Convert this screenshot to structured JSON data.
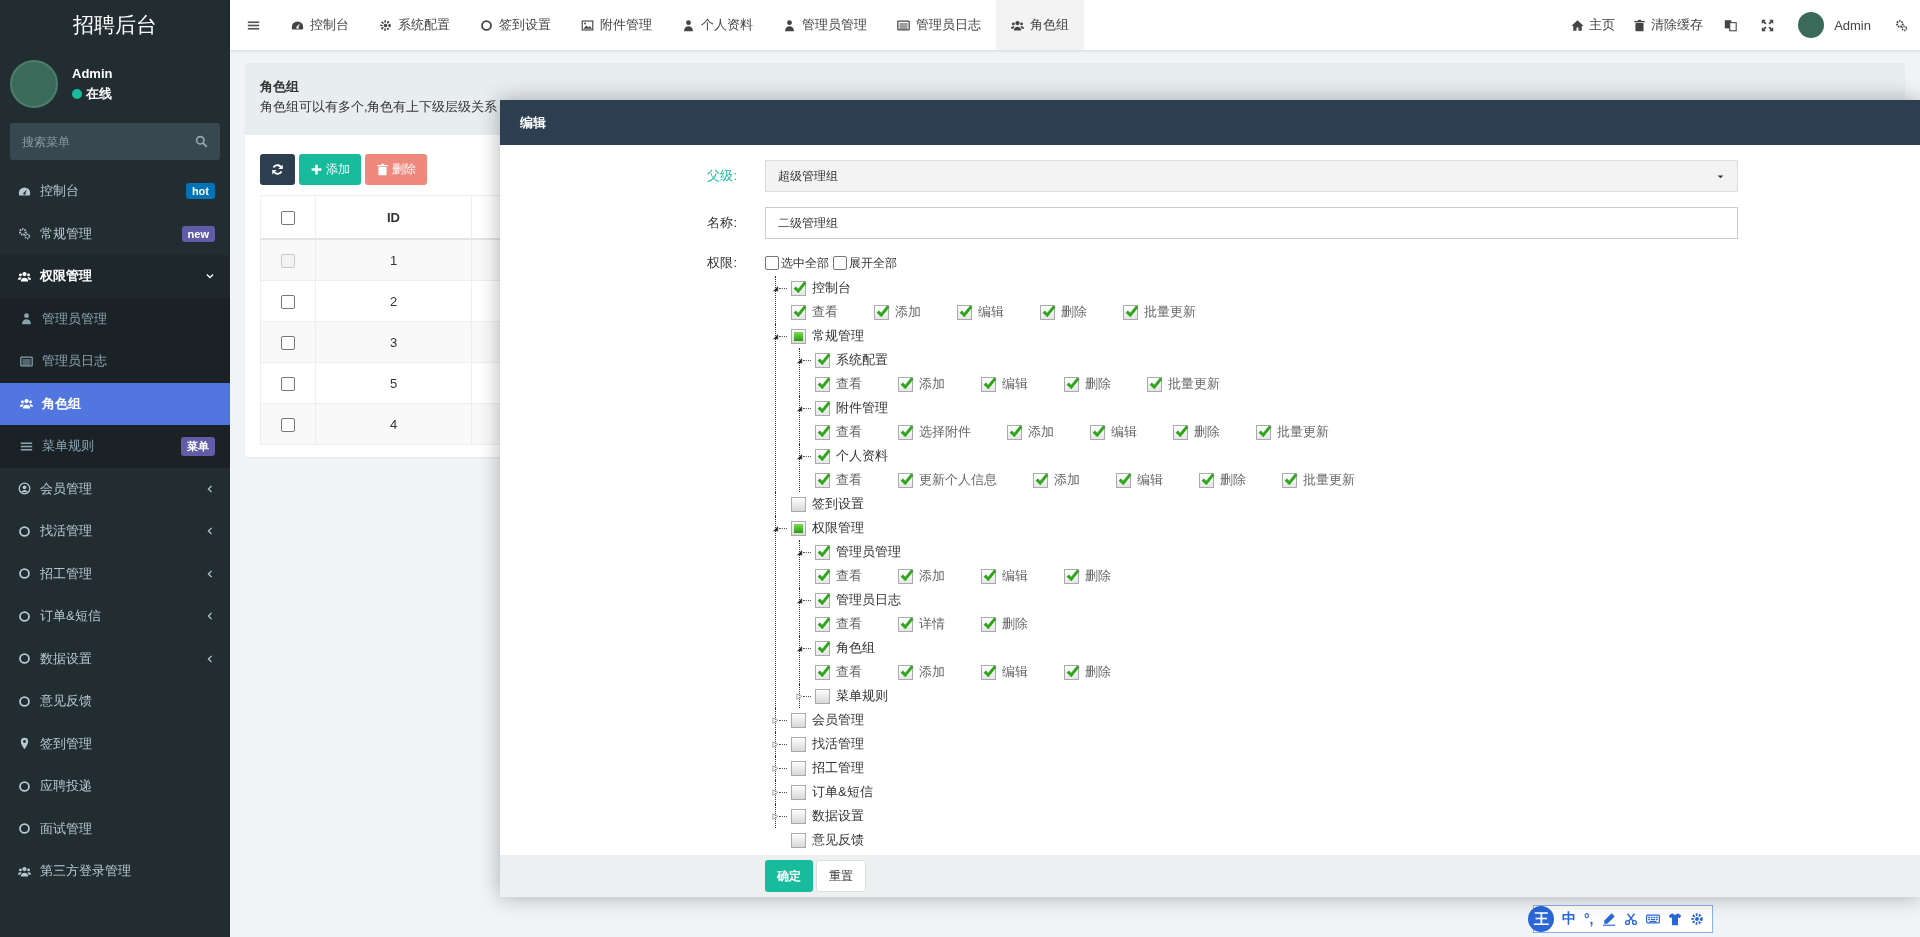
{
  "sidebar": {
    "title": "招聘后台",
    "user": {
      "name": "Admin",
      "status": "在线"
    },
    "search": {
      "placeholder": "搜索菜单"
    },
    "items": [
      {
        "label": "控制台",
        "selected": false,
        "badge": {
          "text": "hot",
          "color": "#0073b7"
        }
      },
      {
        "label": "常规管理",
        "selected": false,
        "badge": {
          "text": "new",
          "color": "#605ca8"
        }
      },
      {
        "label": "权限管理",
        "selected": false,
        "expanded": true,
        "children": [
          {
            "label": "管理员管理",
            "selected": false
          },
          {
            "label": "管理员日志",
            "selected": false
          },
          {
            "label": "角色组",
            "selected": true
          },
          {
            "label": "菜单规则",
            "selected": false,
            "badge": {
              "text": "菜单",
              "color": "#605ca8"
            }
          }
        ]
      },
      {
        "label": "会员管理",
        "selected": false,
        "expanded": false
      },
      {
        "label": "找活管理",
        "selected": false,
        "expanded": false
      },
      {
        "label": "招工管理",
        "selected": false,
        "expanded": false
      },
      {
        "label": "订单&短信",
        "selected": false,
        "expanded": false
      },
      {
        "label": "数据设置",
        "selected": false,
        "expanded": false
      },
      {
        "label": "意见反馈",
        "selected": false
      },
      {
        "label": "签到管理",
        "selected": false
      },
      {
        "label": "应聘投递",
        "selected": false
      },
      {
        "label": "面试管理",
        "selected": false
      },
      {
        "label": "第三方登录管理",
        "selected": false
      }
    ]
  },
  "topbar": {
    "tabs": [
      {
        "label": "控制台",
        "selected": false
      },
      {
        "label": "系统配置",
        "selected": false
      },
      {
        "label": "签到设置",
        "selected": false
      },
      {
        "label": "附件管理",
        "selected": false
      },
      {
        "label": "个人资料",
        "selected": false
      },
      {
        "label": "管理员管理",
        "selected": false
      },
      {
        "label": "管理员日志",
        "selected": false
      },
      {
        "label": "角色组",
        "selected": true
      }
    ],
    "links": [
      "主页",
      "清除缓存"
    ],
    "user": {
      "name": "Admin"
    }
  },
  "page": {
    "title": "角色组",
    "description": "角色组可以有多个,角色有上下级层级关系",
    "toolbar": [
      {
        "kind": "refresh"
      },
      {
        "kind": "add",
        "label": "添加"
      },
      {
        "kind": "delete",
        "label": "删除"
      }
    ],
    "table": {
      "select_all_checked": false,
      "columns": [
        "ID"
      ],
      "rows": [
        {
          "id": "1",
          "disabled": true
        },
        {
          "id": "2",
          "disabled": false
        },
        {
          "id": "3",
          "disabled": false
        },
        {
          "id": "5",
          "disabled": false
        },
        {
          "id": "4",
          "disabled": false
        }
      ]
    }
  },
  "modal": {
    "title": "编辑",
    "fields": [
      {
        "label": "父级:",
        "kind": "select",
        "value": "超级管理组",
        "valid": true
      },
      {
        "label": "名称:",
        "kind": "text",
        "value": "二级管理组",
        "valid": false
      }
    ],
    "permissions": {
      "label": "权限:",
      "options": [
        {
          "label": "选中全部",
          "checked": false
        },
        {
          "label": "展开全部",
          "checked": false
        }
      ],
      "tree": [
        {
          "label": "控制台",
          "checked": true,
          "partial": false,
          "expanded": true,
          "actions": [
            {
              "label": "查看",
              "checked": true
            },
            {
              "label": "添加",
              "checked": true
            },
            {
              "label": "编辑",
              "checked": true
            },
            {
              "label": "删除",
              "checked": true
            },
            {
              "label": "批量更新",
              "checked": true
            }
          ]
        },
        {
          "label": "常规管理",
          "checked": false,
          "partial": true,
          "expanded": true,
          "children": [
            {
              "label": "系统配置",
              "checked": true,
              "partial": false,
              "expanded": true,
              "actions": [
                {
                  "label": "查看",
                  "checked": true
                },
                {
                  "label": "添加",
                  "checked": true
                },
                {
                  "label": "编辑",
                  "checked": true
                },
                {
                  "label": "删除",
                  "checked": true
                },
                {
                  "label": "批量更新",
                  "checked": true
                }
              ]
            },
            {
              "label": "附件管理",
              "checked": true,
              "partial": false,
              "expanded": true,
              "actions": [
                {
                  "label": "查看",
                  "checked": true
                },
                {
                  "label": "选择附件",
                  "checked": true
                },
                {
                  "label": "添加",
                  "checked": true
                },
                {
                  "label": "编辑",
                  "checked": true
                },
                {
                  "label": "删除",
                  "checked": true
                },
                {
                  "label": "批量更新",
                  "checked": true
                }
              ]
            },
            {
              "label": "个人资料",
              "checked": true,
              "partial": false,
              "expanded": true,
              "actions": [
                {
                  "label": "查看",
                  "checked": true
                },
                {
                  "label": "更新个人信息",
                  "checked": true
                },
                {
                  "label": "添加",
                  "checked": true
                },
                {
                  "label": "编辑",
                  "checked": true
                },
                {
                  "label": "删除",
                  "checked": true
                },
                {
                  "label": "批量更新",
                  "checked": true
                }
              ]
            }
          ]
        },
        {
          "label": "签到设置",
          "checked": false,
          "partial": false
        },
        {
          "label": "权限管理",
          "checked": false,
          "partial": true,
          "expanded": true,
          "children": [
            {
              "label": "管理员管理",
              "checked": true,
              "partial": false,
              "expanded": true,
              "actions": [
                {
                  "label": "查看",
                  "checked": true
                },
                {
                  "label": "添加",
                  "checked": true
                },
                {
                  "label": "编辑",
                  "checked": true
                },
                {
                  "label": "删除",
                  "checked": true
                }
              ]
            },
            {
              "label": "管理员日志",
              "checked": true,
              "partial": false,
              "expanded": true,
              "actions": [
                {
                  "label": "查看",
                  "checked": true
                },
                {
                  "label": "详情",
                  "checked": true
                },
                {
                  "label": "删除",
                  "checked": true
                }
              ]
            },
            {
              "label": "角色组",
              "checked": true,
              "partial": false,
              "expanded": true,
              "actions": [
                {
                  "label": "查看",
                  "checked": true
                },
                {
                  "label": "添加",
                  "checked": true
                },
                {
                  "label": "编辑",
                  "checked": true
                },
                {
                  "label": "删除",
                  "checked": true
                }
              ]
            },
            {
              "label": "菜单规则",
              "checked": false,
              "partial": false,
              "expanded": false
            }
          ]
        },
        {
          "label": "会员管理",
          "checked": false,
          "partial": false,
          "expanded": false
        },
        {
          "label": "找活管理",
          "checked": false,
          "partial": false,
          "expanded": false
        },
        {
          "label": "招工管理",
          "checked": false,
          "partial": false,
          "expanded": false
        },
        {
          "label": "订单&短信",
          "checked": false,
          "partial": false,
          "expanded": false
        },
        {
          "label": "数据设置",
          "checked": false,
          "partial": false,
          "expanded": false
        },
        {
          "label": "意见反馈",
          "checked": false,
          "partial": false
        }
      ]
    },
    "buttons": [
      {
        "label": "确定",
        "kind": "primary"
      },
      {
        "label": "重置",
        "kind": "default"
      }
    ]
  },
  "ime_toolbar": {
    "logo": "王",
    "mode": "中",
    "punctuation": "°,"
  }
}
